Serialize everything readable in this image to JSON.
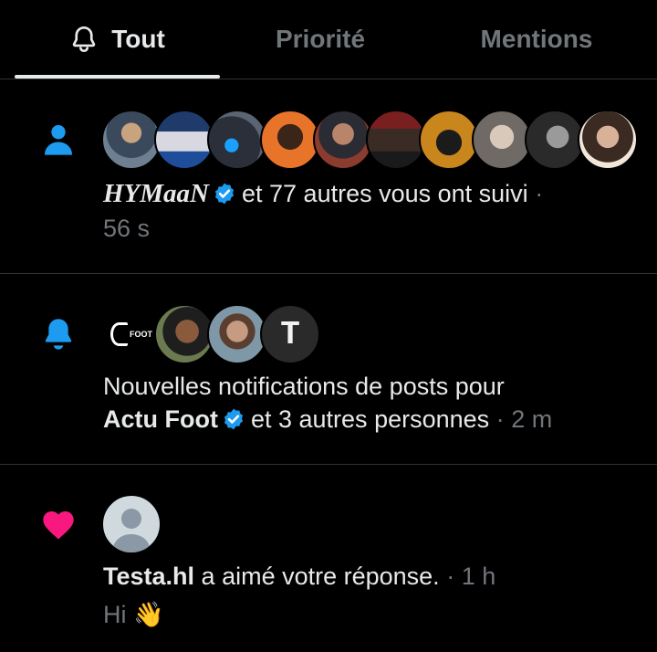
{
  "tabs": [
    {
      "label": "Tout",
      "icon": "bell-outline-icon",
      "active": true
    },
    {
      "label": "Priorité",
      "active": false
    },
    {
      "label": "Mentions",
      "active": false
    }
  ],
  "colors": {
    "accent": "#1d9bf0",
    "like": "#f91880",
    "muted": "#71767b",
    "text": "#e7e9ea",
    "divider": "#2f3336"
  },
  "notifications": [
    {
      "type": "follow",
      "icon": "person-icon",
      "avatar_count": 11,
      "name": "HYMaaN",
      "verified": true,
      "text": "et 77 autres vous ont suivi",
      "separator": "·",
      "time": "56 s"
    },
    {
      "type": "post-notification",
      "icon": "bell-icon",
      "avatar_count": 4,
      "line1": "Nouvelles notifications de posts pour",
      "name": "Actu Foot",
      "verified": true,
      "text": "et 3 autres personnes",
      "separator": "·",
      "time": "2 m",
      "avatar_logo_text": "FOOT",
      "avatar_letter": "T"
    },
    {
      "type": "like",
      "icon": "heart-icon",
      "avatar_count": 1,
      "name": "Testa.hl",
      "text": "a aimé votre réponse.",
      "separator": "·",
      "time": "1 h",
      "preview": "Hi 👋"
    }
  ]
}
